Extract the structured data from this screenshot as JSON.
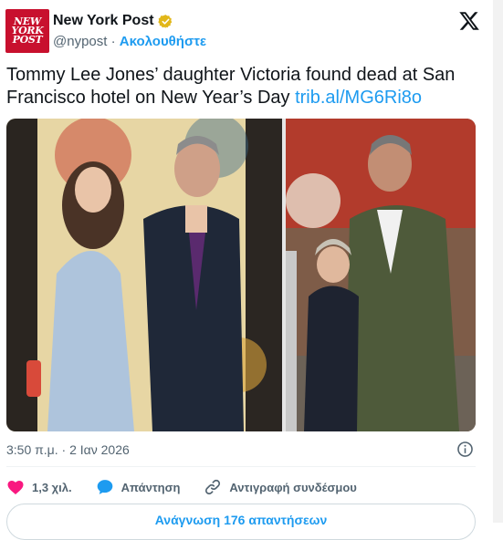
{
  "account": {
    "avatar_text": [
      "NEW",
      "YORK",
      "POST"
    ],
    "name": "New York Post",
    "handle": "@nypost",
    "separator": "·",
    "follow_label": "Ακολουθήστε",
    "verified": true
  },
  "tweet": {
    "text": "Tommy Lee Jones’ daughter Victoria found dead at San Francisco hotel on New Year’s Day ",
    "link": "trib.al/MG6Ri8o",
    "timestamp": "3:50 π.μ. · 2 Ιαν 2026"
  },
  "media": {
    "count": 2
  },
  "actions": {
    "likes": "1,3 χιλ.",
    "reply_label": "Απάντηση",
    "copy_link_label": "Αντιγραφή συνδέσμου"
  },
  "read_replies_label": "Ανάγνωση 176 απαντήσεων",
  "colors": {
    "accent": "#1d9bf0",
    "like": "#f91880",
    "brand": "#c8102e",
    "verified_gold": "#e2b719"
  },
  "icons": [
    "verified-badge-icon",
    "x-logo-icon",
    "info-icon",
    "heart-icon",
    "reply-icon",
    "link-icon"
  ]
}
